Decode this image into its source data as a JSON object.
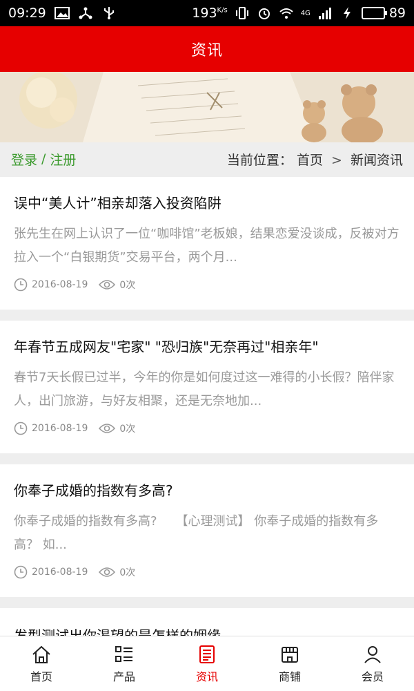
{
  "status_bar": {
    "time": "09:29",
    "speed": "193",
    "speed_unit": "K/s",
    "network": "4G",
    "battery_level": "89",
    "battery_fraction": 0.89,
    "icons": [
      "image-icon",
      "usb-share-icon",
      "usb-icon",
      "vibrate-icon",
      "alarm-icon",
      "wifi-icon",
      "signal-icon",
      "charging-icon",
      "battery-icon"
    ]
  },
  "header": {
    "title": "资讯"
  },
  "nav": {
    "login": "登录",
    "separator": "/",
    "register": "注册",
    "location_label": "当前位置：",
    "crumb_home": "首页",
    "crumb_gt": ">",
    "crumb_current": "新闻资讯"
  },
  "articles": [
    {
      "title": "误中“美人计”相亲却落入投资陷阱",
      "summary": "张先生在网上认识了一位“咖啡馆”老板娘，结果恋爱没谈成，反被对方拉入一个“白银期货”交易平台，两个月...",
      "date": "2016-08-19",
      "views": "0次"
    },
    {
      "title": "年春节五成网友\"宅家\" \"恐归族\"无奈再过\"相亲年\"",
      "summary": "春节7天长假已过半，今年的你是如何度过这一难得的小长假？陪伴家人，出门旅游，与好友相聚，还是无奈地加...",
      "date": "2016-08-19",
      "views": "0次"
    },
    {
      "title": "你奉子成婚的指数有多高?",
      "summary": "你奉子成婚的指数有多高?　　【心理测试】 你奉子成婚的指数有多高？ 如...",
      "date": "2016-08-19",
      "views": "0次"
    },
    {
      "title": "发型测试出你渴望的是怎样的姻缘"
    }
  ],
  "tabbar": {
    "tabs": [
      {
        "label": "首页",
        "icon": "home-icon"
      },
      {
        "label": "产品",
        "icon": "list-icon"
      },
      {
        "label": "资讯",
        "icon": "news-icon",
        "active": true
      },
      {
        "label": "商铺",
        "icon": "shop-icon"
      },
      {
        "label": "会员",
        "icon": "user-icon"
      }
    ],
    "active_color": "#e60000"
  },
  "colors": {
    "header_red": "#e60000",
    "link_green": "#3b9a2d",
    "battery_green": "#2ecc40"
  }
}
